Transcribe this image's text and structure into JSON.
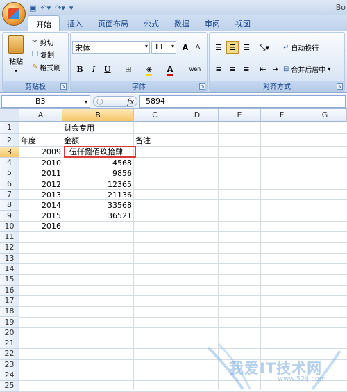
{
  "titlebar": {
    "right_text": "Bo"
  },
  "ribbon_tabs": [
    "开始",
    "插入",
    "页面布局",
    "公式",
    "数据",
    "审阅",
    "视图"
  ],
  "clipboard": {
    "paste": "粘贴",
    "cut": "剪切",
    "copy": "复制",
    "format_painter": "格式刷",
    "group_label": "剪贴板"
  },
  "font": {
    "name": "宋体",
    "size": "11",
    "bold": "B",
    "italic": "I",
    "underline": "U",
    "grow": "A",
    "shrink": "A",
    "font_color_glyph": "A",
    "wen": "wén",
    "group_label": "字体"
  },
  "alignment": {
    "wrap_text": "自动换行",
    "merge_center": "合并后居中",
    "group_label": "对齐方式"
  },
  "formula_bar": {
    "name_box": "B3",
    "fx": "fx",
    "content": "5894"
  },
  "columns": [
    "A",
    "B",
    "C",
    "D",
    "E",
    "F",
    "G"
  ],
  "rows": [
    "1",
    "2",
    "3",
    "4",
    "5",
    "6",
    "7",
    "8",
    "9",
    "10",
    "11",
    "12",
    "13",
    "14",
    "15",
    "16",
    "17",
    "18",
    "19",
    "20",
    "21",
    "22",
    "23",
    "24",
    "25"
  ],
  "cells": {
    "B1": "财会专用",
    "A2": "年度",
    "B2": "金额",
    "C2": "备注",
    "A3": "2009",
    "B3": "伍仟捌佰玖拾肆",
    "A4": "2010",
    "B4": "4568",
    "A5": "2011",
    "B5": "9856",
    "A6": "2012",
    "B6": "12365",
    "A7": "2013",
    "B7": "21136",
    "A8": "2014",
    "B8": "33568",
    "A9": "2015",
    "B9": "36521",
    "A10": "2016"
  },
  "watermark": {
    "text": "我爱IT技术网",
    "url": "www.52ij.com"
  }
}
